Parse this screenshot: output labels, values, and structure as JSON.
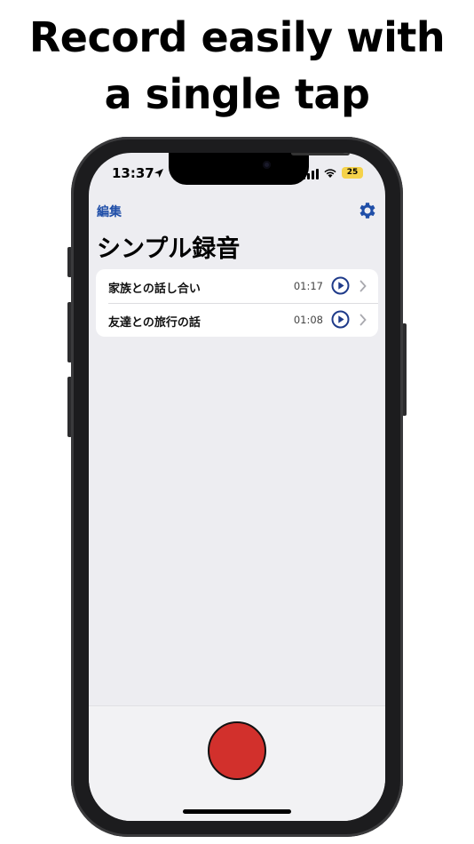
{
  "headline": {
    "line1": "Record easily with",
    "line2": "a single tap"
  },
  "status_bar": {
    "time": "13:37",
    "battery": "25"
  },
  "nav": {
    "edit_label": "編集",
    "settings_icon": "gear-icon"
  },
  "page": {
    "title": "シンプル録音"
  },
  "recordings": [
    {
      "title": "家族との話し合い",
      "duration": "01:17"
    },
    {
      "title": "友達との旅行の話",
      "duration": "01:08"
    }
  ],
  "colors": {
    "accent": "#1f4ea8",
    "record": "#d2302c",
    "background": "#ededf1"
  }
}
